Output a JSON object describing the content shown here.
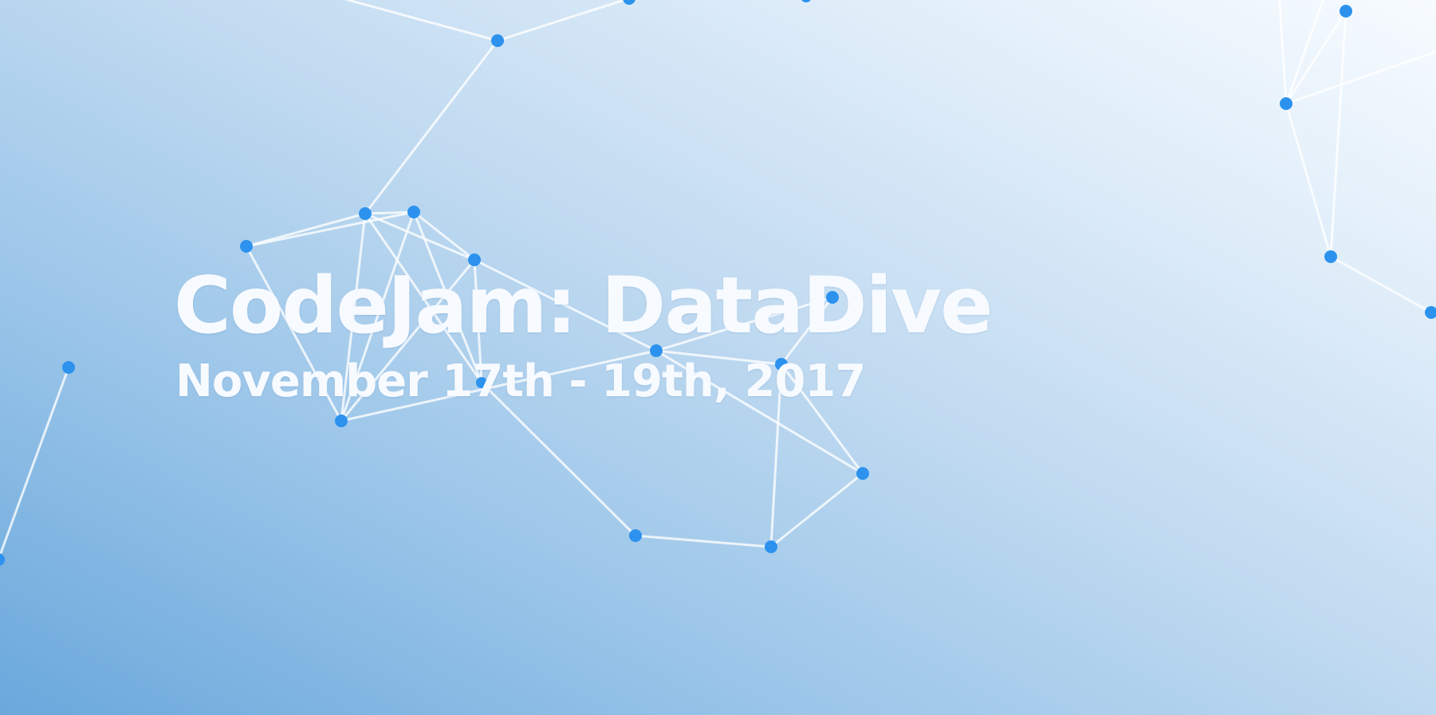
{
  "hero": {
    "title": "CodeJam: DataDive",
    "date": "November 17th - 19th, 2017"
  },
  "colors": {
    "background_start": "#6aa8dc",
    "background_end": "#f7fbff",
    "node": "#2c92ee",
    "edge": "#ffffff",
    "text": "#f7faff"
  }
}
